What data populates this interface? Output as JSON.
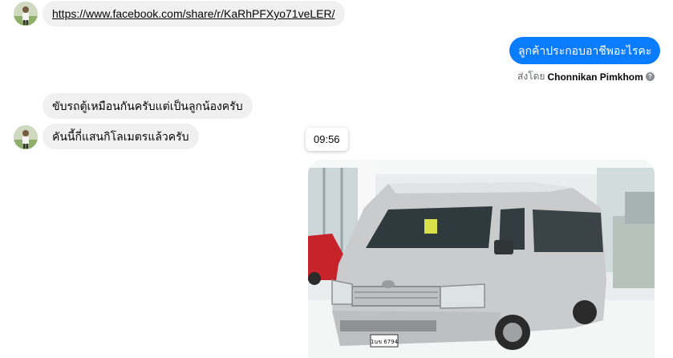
{
  "messages": {
    "link": {
      "text": "https://www.facebook.com/share/r/KaRhPFXyo71veLER/"
    },
    "outgoing": {
      "text": "ลูกค้าประกอบอาชีพอะไรคะ"
    },
    "sent_by": {
      "prefix": "ส่งโดย",
      "name": "Chonnikan Pimkhom"
    },
    "reply_1": {
      "text": "ขับรถตู้เหมือนกันครับแต่เป็นลูกน้องครับ"
    },
    "reply_2": {
      "text": "คันนี้กี่แสนกิโลเมตรแล้วครับ"
    },
    "timestamp": "09:56",
    "photo": {
      "plate": "1นข 6794"
    }
  },
  "colors": {
    "outgoing_bubble": "#0a7cff",
    "incoming_bubble": "#f0f0f0"
  },
  "icons": [
    "avatar",
    "help-icon"
  ]
}
